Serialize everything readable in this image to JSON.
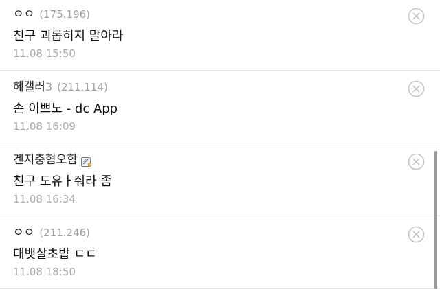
{
  "comments": [
    {
      "author": "ㅇㅇ",
      "author_suffix": "",
      "ip": "(175.196)",
      "has_gallog_icon": false,
      "text": "친구 괴롭히지 말아라",
      "date": "11.08 15:50"
    },
    {
      "author": "헤갤러",
      "author_suffix": "3",
      "ip": "(211.114)",
      "has_gallog_icon": false,
      "text": "손 이쁘노 - dc App",
      "date": "11.08 16:09"
    },
    {
      "author": "겐지충혐오함",
      "author_suffix": "",
      "ip": "",
      "has_gallog_icon": true,
      "text": "친구 도유ㅏ줘라 좀",
      "date": "11.08 16:34"
    },
    {
      "author": "ㅇㅇ",
      "author_suffix": "",
      "ip": "(211.246)",
      "has_gallog_icon": false,
      "text": "대뱃살초밥 ㄷㄷ",
      "date": "11.08 18:50"
    }
  ],
  "icons": {
    "delete": "close-circle-icon",
    "gallog": "gallog-icon"
  },
  "colors": {
    "author": "#222222",
    "ip": "#a0a0a0",
    "text": "#111111",
    "date": "#a8a8a8",
    "divider": "#e2e2e2",
    "delete_icon": "#c4c4c4",
    "scrollbar": "#9a9a9a"
  }
}
